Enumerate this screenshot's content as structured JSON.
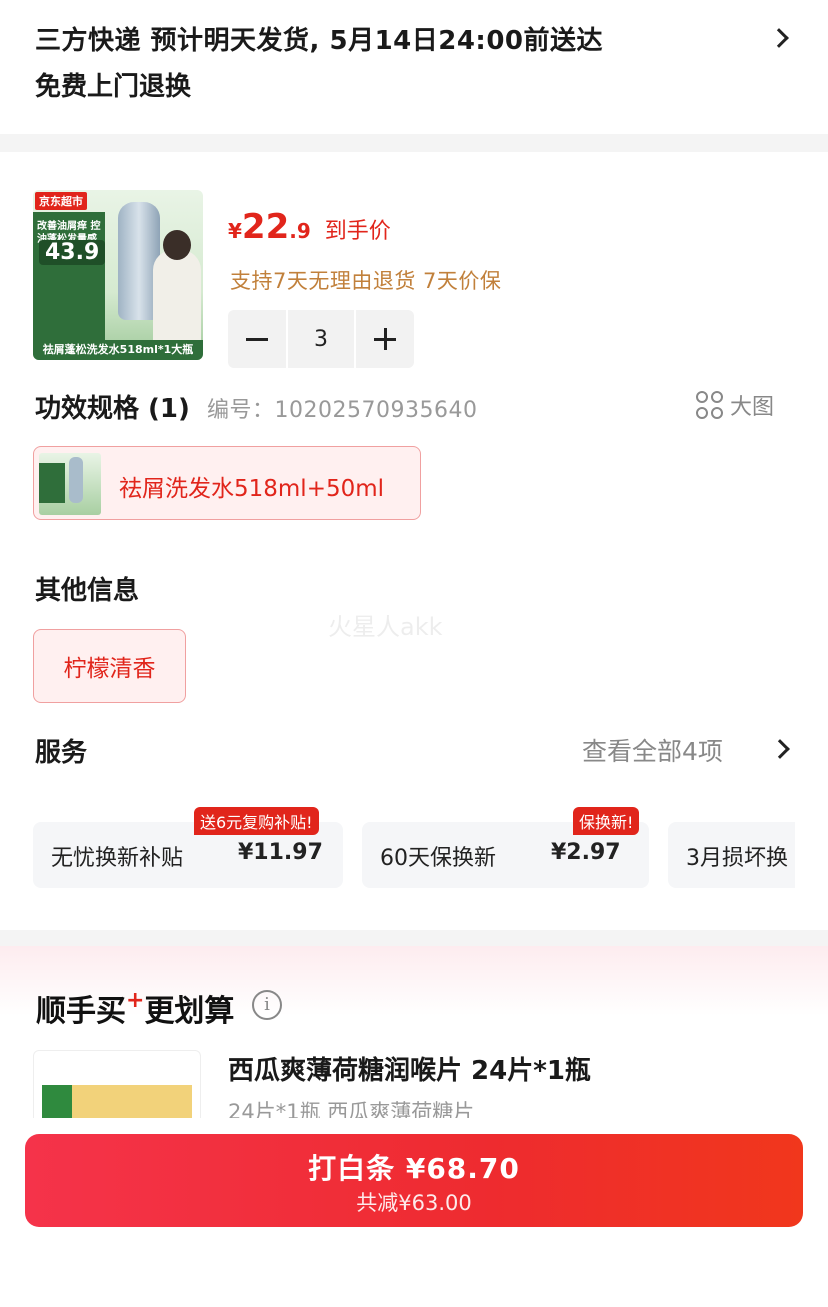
{
  "delivery": {
    "line1": "三方快递 预计明天发货, 5月14日24:00前送达",
    "line2": "免费上门退换"
  },
  "product": {
    "thumb": {
      "brand_badge": "京东超市",
      "promo_text": "改善油屑痒 控油蓬松发量感",
      "promo_price": "43.9",
      "caption": "祛屑蓬松洗发水518ml*1大瓶"
    },
    "price": {
      "currency": "¥",
      "integer": "22",
      "decimal": ".9",
      "label": "到手价"
    },
    "policy": "支持7天无理由退货   7天价保",
    "quantity": "3"
  },
  "spec": {
    "title": "功效规格 (1)",
    "code": "编号：10202570935640",
    "big_image_label": "大图",
    "option_label": "祛屑洗发水518ml+50ml"
  },
  "other": {
    "title": "其他信息",
    "option_label": "柠檬清香"
  },
  "watermark": "火星人akk",
  "services": {
    "title": "服务",
    "view_all": "查看全部4项",
    "items": [
      {
        "name": "无忧换新补贴",
        "price": "¥11.97",
        "badge": "送6元复购补贴!"
      },
      {
        "name": "60天保换新",
        "price": "¥2.97",
        "badge": "保换新!"
      },
      {
        "name": "3月损坏换",
        "price": "",
        "badge": ""
      }
    ]
  },
  "recommend": {
    "title": "顺手买更划算",
    "title_plus": "+",
    "info_icon_text": "i",
    "item_name": "西瓜爽薄荷糖润喉片 24片*1瓶",
    "item_sub": "24片*1瓶 西瓜爽薄荷糖片"
  },
  "checkout": {
    "button_label": "打白条 ¥68.70",
    "discount_label": "共减¥63.00"
  },
  "colors": {
    "accent": "#e1251b",
    "policy": "#c1803b",
    "muted": "#999999"
  }
}
